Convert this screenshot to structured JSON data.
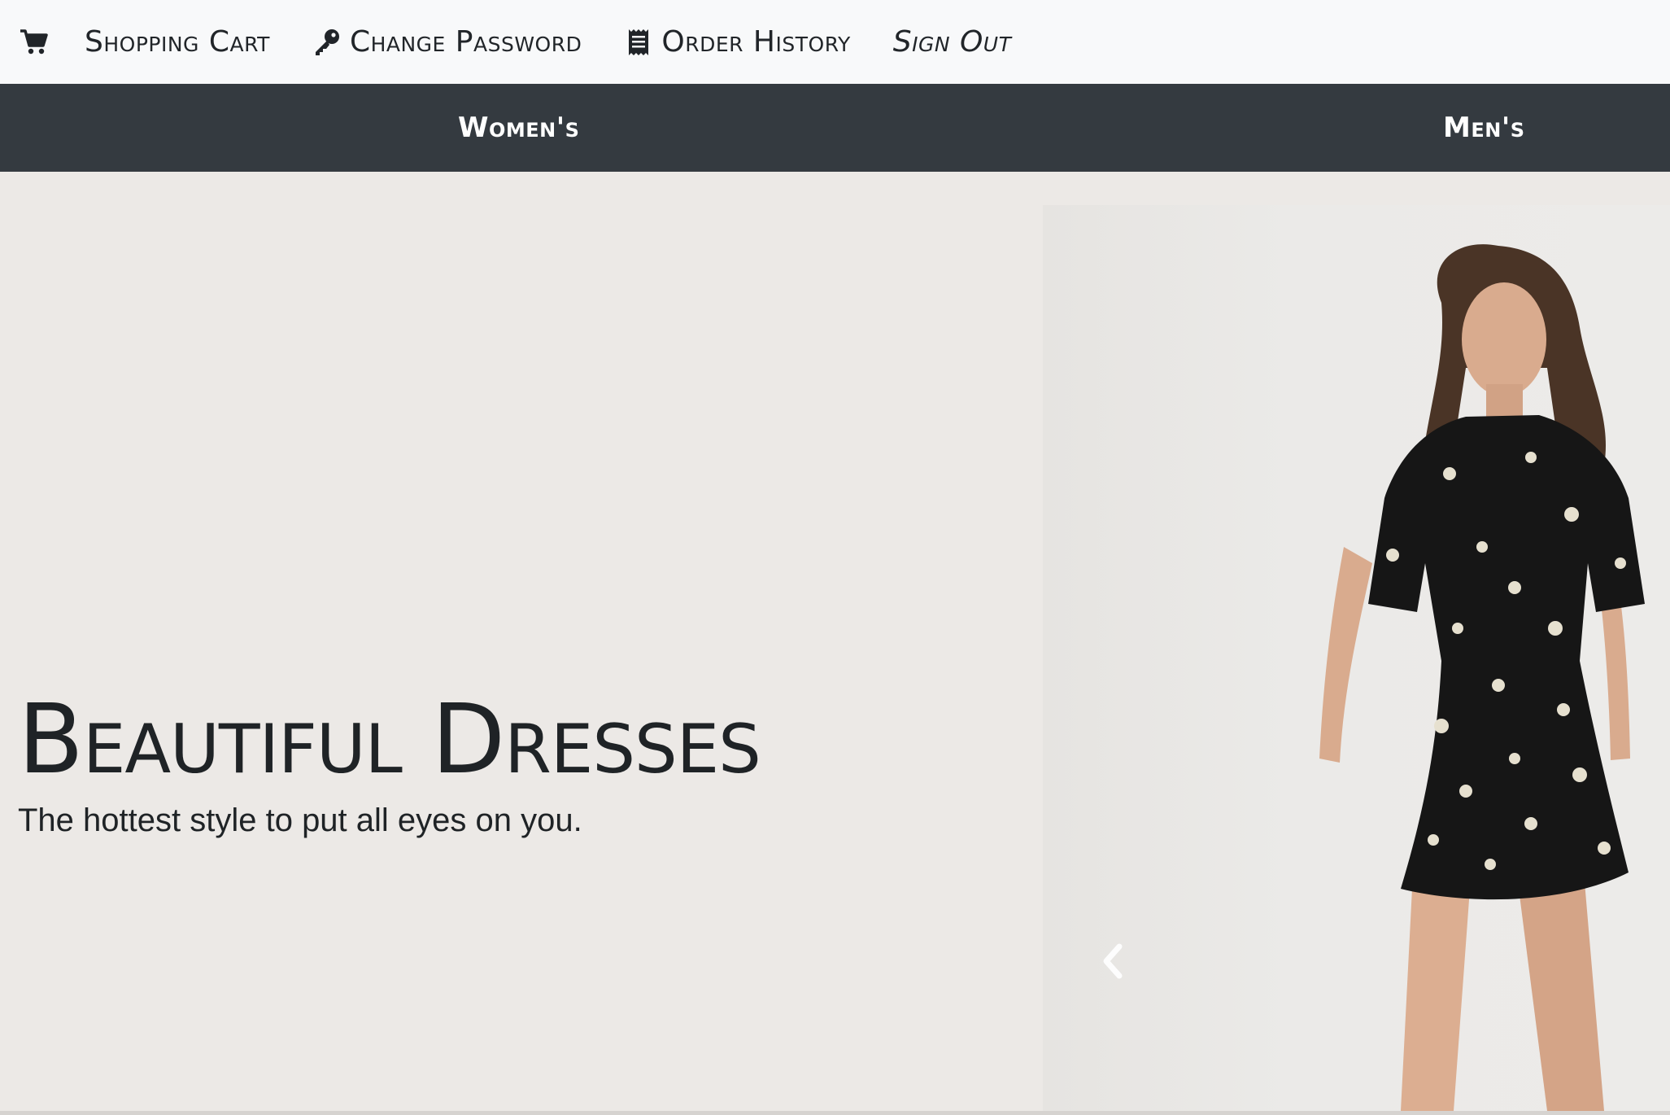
{
  "topnav": {
    "cart_icon": "shopping-cart-icon",
    "shopping_cart": "Shopping Cart",
    "change_password_icon": "key-icon",
    "change_password": "Change Password",
    "order_history_icon": "receipt-icon",
    "order_history": "Order History",
    "sign_out": "Sign Out"
  },
  "categories": {
    "women": "Women's",
    "men": "Men's"
  },
  "hero": {
    "title": "Beautiful Dresses",
    "subtitle": "The hottest style to put all eyes on you.",
    "prev_icon": "chevron-left-icon"
  },
  "colors": {
    "topbar_bg": "#f8f9fa",
    "catbar_bg": "#343a40",
    "hero_bg": "#ece9e6",
    "text_dark": "#1f2326"
  }
}
